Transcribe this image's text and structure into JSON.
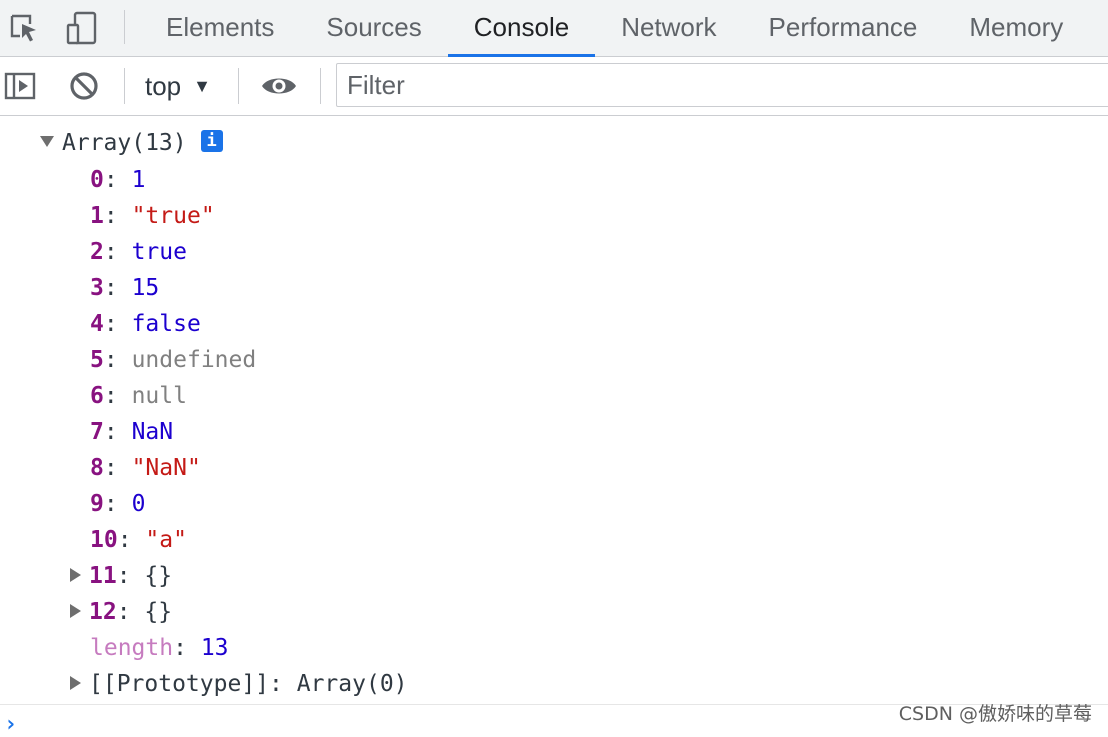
{
  "tabs": [
    {
      "label": "Elements",
      "active": false
    },
    {
      "label": "Sources",
      "active": false
    },
    {
      "label": "Console",
      "active": true
    },
    {
      "label": "Network",
      "active": false
    },
    {
      "label": "Performance",
      "active": false
    },
    {
      "label": "Memory",
      "active": false
    }
  ],
  "icons": {
    "inspect": "inspect-element-icon",
    "device": "device-toolbar-icon",
    "sidebar": "show-sidebar-icon",
    "clear": "clear-console-icon",
    "eye": "live-expression-icon",
    "info": "info-icon"
  },
  "toolbar": {
    "context_value": "top",
    "filter_placeholder": "Filter",
    "filter_value": ""
  },
  "console": {
    "header": {
      "label": "Array(13)",
      "info_glyph": "i"
    },
    "entries": [
      {
        "key": "0",
        "value": "1",
        "kind": "number"
      },
      {
        "key": "1",
        "value": "\"true\"",
        "kind": "string"
      },
      {
        "key": "2",
        "value": "true",
        "kind": "bool"
      },
      {
        "key": "3",
        "value": "15",
        "kind": "number"
      },
      {
        "key": "4",
        "value": "false",
        "kind": "bool"
      },
      {
        "key": "5",
        "value": "undefined",
        "kind": "nullish"
      },
      {
        "key": "6",
        "value": "null",
        "kind": "nullish"
      },
      {
        "key": "7",
        "value": "NaN",
        "kind": "number"
      },
      {
        "key": "8",
        "value": "\"NaN\"",
        "kind": "string"
      },
      {
        "key": "9",
        "value": "0",
        "kind": "number"
      },
      {
        "key": "10",
        "value": "\"a\"",
        "kind": "string"
      },
      {
        "key": "11",
        "value": "{}",
        "kind": "object"
      },
      {
        "key": "12",
        "value": "{}",
        "kind": "object"
      }
    ],
    "length": {
      "key": "length",
      "value": "13"
    },
    "prototype": {
      "key": "[[Prototype]]",
      "value": "Array(0)"
    },
    "colon": ":"
  },
  "watermark": "CSDN @傲娇味的草莓",
  "colors": {
    "accent": "#1a73e8",
    "key": "#881280",
    "string": "#c41a16",
    "number": "#1c00cf",
    "nullish": "#808080"
  }
}
